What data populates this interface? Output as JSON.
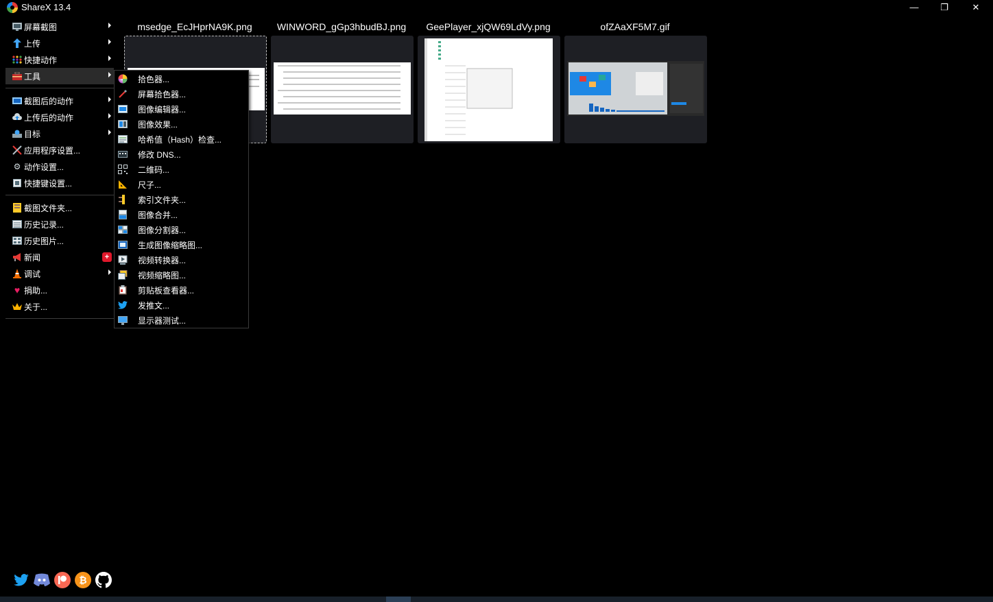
{
  "window": {
    "title": "ShareX 13.4",
    "minimize_glyph": "—",
    "restore_glyph": "❐",
    "close_glyph": "✕"
  },
  "sidebar": {
    "items": [
      {
        "label": "屏幕截图",
        "icon": "monitor-capture-icon",
        "arrow": true
      },
      {
        "label": "上传",
        "icon": "upload-arrow-icon",
        "arrow": true
      },
      {
        "label": "快捷动作",
        "icon": "grid-dots-icon",
        "arrow": true
      },
      {
        "label": "工具",
        "icon": "toolbox-icon",
        "arrow": true,
        "active": true
      },
      {
        "label": "截图后的动作",
        "icon": "after-capture-icon",
        "arrow": true
      },
      {
        "label": "上传后的动作",
        "icon": "cloud-upload-icon",
        "arrow": true
      },
      {
        "label": "目标",
        "icon": "destination-icon",
        "arrow": true
      },
      {
        "label": "应用程序设置...",
        "icon": "tools-icon"
      },
      {
        "label": "动作设置...",
        "icon": "gear-icon"
      },
      {
        "label": "快捷键设置...",
        "icon": "keyboard-icon"
      },
      {
        "label": "截图文件夹...",
        "icon": "folder-icon"
      },
      {
        "label": "历史记录...",
        "icon": "history-icon"
      },
      {
        "label": "历史图片...",
        "icon": "image-history-icon"
      },
      {
        "label": "新闻",
        "icon": "megaphone-icon",
        "badge": "+"
      },
      {
        "label": "调试",
        "icon": "debug-cone-icon",
        "arrow": true
      },
      {
        "label": "捐助...",
        "icon": "heart-icon"
      },
      {
        "label": "关于...",
        "icon": "crown-icon"
      }
    ]
  },
  "tools_submenu": {
    "items": [
      {
        "label": "拾色器...",
        "icon": "color-wheel-icon"
      },
      {
        "label": "屏幕拾色器...",
        "icon": "eyedropper-icon"
      },
      {
        "label": "图像编辑器...",
        "icon": "image-editor-icon"
      },
      {
        "label": "图像效果...",
        "icon": "image-effects-icon"
      },
      {
        "label": "哈希值（Hash）检查...",
        "icon": "hash-check-icon"
      },
      {
        "label": "修改 DNS...",
        "icon": "dns-icon"
      },
      {
        "label": "二维码...",
        "icon": "qr-code-icon"
      },
      {
        "label": "尺子...",
        "icon": "ruler-icon"
      },
      {
        "label": "索引文件夹...",
        "icon": "index-folder-icon"
      },
      {
        "label": "图像合并...",
        "icon": "image-combiner-icon"
      },
      {
        "label": "图像分割器...",
        "icon": "image-splitter-icon"
      },
      {
        "label": "生成图像缩略图...",
        "icon": "thumbnailer-icon"
      },
      {
        "label": "视频转换器...",
        "icon": "video-converter-icon"
      },
      {
        "label": "视频缩略图...",
        "icon": "video-thumbnail-icon"
      },
      {
        "label": "剪贴板查看器...",
        "icon": "clipboard-icon"
      },
      {
        "label": "发推文...",
        "icon": "twitter-bird-icon"
      },
      {
        "label": "显示器测试...",
        "icon": "monitor-test-icon"
      }
    ]
  },
  "thumbnails": [
    {
      "filename": "msedge_EcJHprNA9K.png"
    },
    {
      "filename": "WINWORD_gGp3hbudBJ.png"
    },
    {
      "filename": "GeePlayer_xjQW69LdVy.png"
    },
    {
      "filename": "ofZAaXF5M7.gif"
    }
  ],
  "social_icons": [
    "twitter-icon",
    "discord-icon",
    "patreon-icon",
    "bitcoin-icon",
    "github-icon"
  ],
  "colors": {
    "background": "#000000",
    "thumb_bg": "#1e1f24",
    "badge_red": "#e0182b",
    "twitter_blue": "#1da1f2",
    "discord_blue": "#7289da",
    "patreon_orange": "#f96854",
    "bitcoin_orange": "#f7931a"
  }
}
